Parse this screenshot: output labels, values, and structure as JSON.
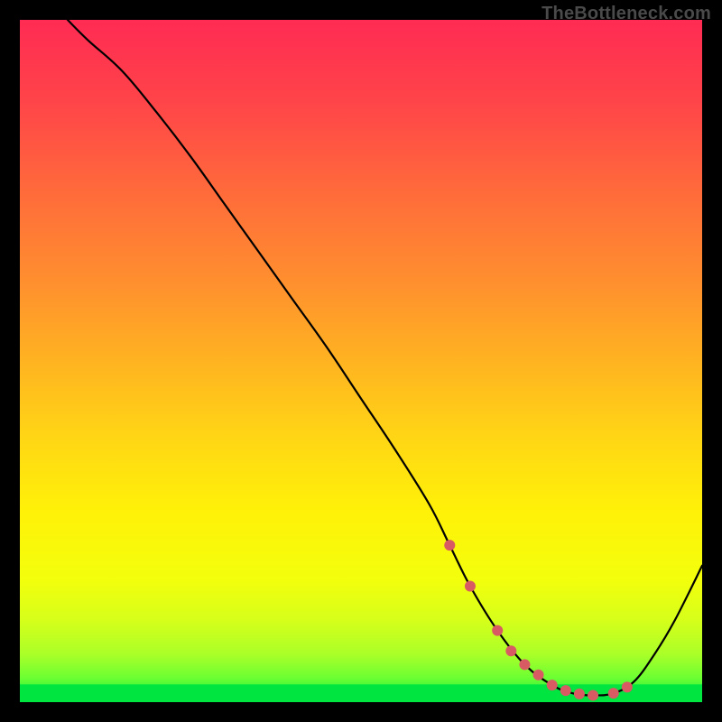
{
  "watermark": "TheBottleneck.com",
  "colors": {
    "black": "#000000",
    "curve_stroke": "#000000",
    "marker_fill": "#d85a63",
    "green_band": "#00e53f",
    "watermark_text": "#4a4a4a"
  },
  "gradient_stops": [
    {
      "offset": 0.0,
      "color": "#ff2b53"
    },
    {
      "offset": 0.12,
      "color": "#ff4449"
    },
    {
      "offset": 0.25,
      "color": "#ff6a3b"
    },
    {
      "offset": 0.38,
      "color": "#ff8e2f"
    },
    {
      "offset": 0.5,
      "color": "#ffb321"
    },
    {
      "offset": 0.62,
      "color": "#ffd814"
    },
    {
      "offset": 0.72,
      "color": "#fff108"
    },
    {
      "offset": 0.82,
      "color": "#f3ff0c"
    },
    {
      "offset": 0.88,
      "color": "#d6ff1a"
    },
    {
      "offset": 0.93,
      "color": "#aaff28"
    },
    {
      "offset": 0.965,
      "color": "#6bff33"
    },
    {
      "offset": 1.0,
      "color": "#00e53f"
    }
  ],
  "chart_data": {
    "type": "line",
    "title": "",
    "xlabel": "",
    "ylabel": "",
    "xlim": [
      0,
      100
    ],
    "ylim": [
      0,
      100
    ],
    "grid": false,
    "legend": false,
    "series": [
      {
        "name": "bottleneck-curve",
        "x": [
          7,
          10,
          15,
          20,
          25,
          30,
          35,
          40,
          45,
          50,
          55,
          60,
          63,
          66,
          70,
          74,
          78,
          81,
          84,
          87,
          90,
          93,
          96,
          100
        ],
        "y": [
          100,
          97,
          92.5,
          86.5,
          80,
          73,
          66,
          59,
          52,
          44.5,
          37,
          29,
          23,
          17,
          10.5,
          5.5,
          2.5,
          1.3,
          1.0,
          1.3,
          3.0,
          7,
          12,
          20
        ]
      }
    ],
    "markers": {
      "name": "optimal-range-markers",
      "x": [
        63,
        66,
        70,
        72,
        74,
        76,
        78,
        80,
        82,
        84,
        87,
        89
      ],
      "y": [
        23,
        17,
        10.5,
        7.5,
        5.5,
        4,
        2.5,
        1.7,
        1.2,
        1.0,
        1.3,
        2.2
      ]
    },
    "green_band_y_range": [
      0,
      2.6
    ]
  }
}
